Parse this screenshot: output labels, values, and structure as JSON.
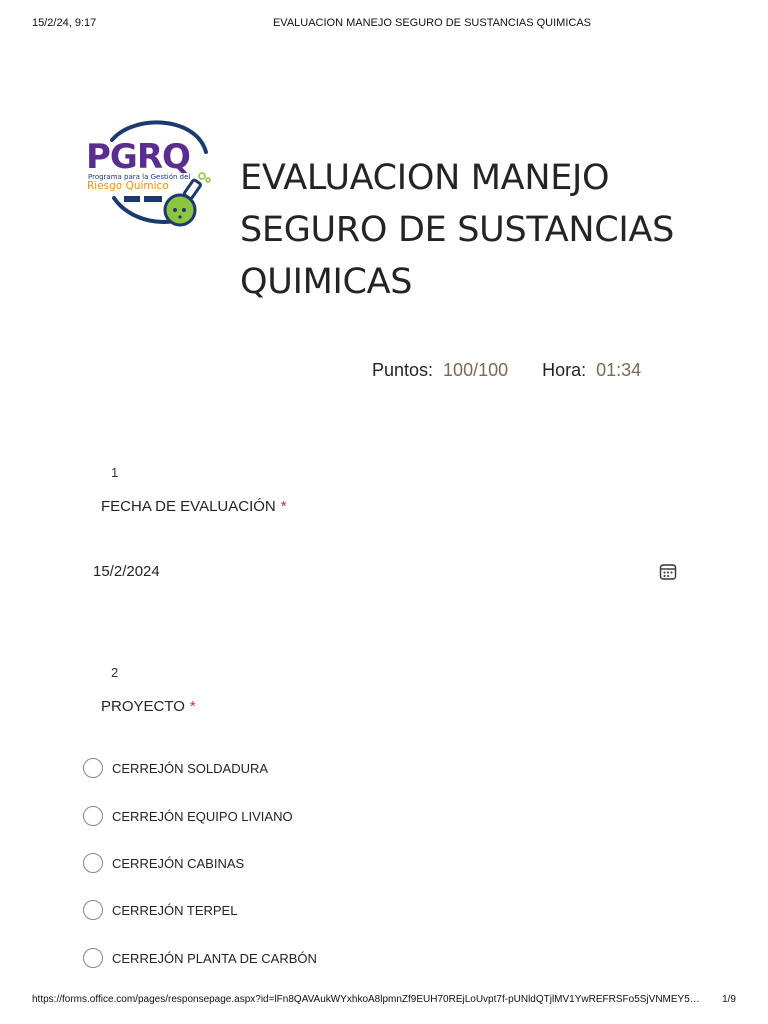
{
  "print_header": {
    "datetime": "15/2/24, 9:17",
    "title": "EVALUACION MANEJO SEGURO DE SUSTANCIAS QUIMICAS"
  },
  "logo": {
    "brand": "PGRQ",
    "line1": "Programa para la Gestión del",
    "line2": "Riesgo Químico",
    "colors": {
      "purple": "#5b2d8e",
      "green": "#8cc63f",
      "orange": "#f39200",
      "navy": "#1d3a6e"
    }
  },
  "form": {
    "title": "EVALUACION MANEJO SEGURO DE SUSTANCIAS QUIMICAS",
    "score_label": "Puntos:",
    "score_value": "100/100",
    "time_label": "Hora:",
    "time_value": "01:34"
  },
  "questions": [
    {
      "number": "1",
      "title": "FECHA DE EVALUACIÓN",
      "required_mark": "*",
      "answer": "15/2/2024",
      "icon": "calendar-icon"
    },
    {
      "number": "2",
      "title": "PROYECTO",
      "required_mark": "*",
      "options": [
        "CERREJÓN SOLDADURA",
        "CERREJÓN EQUIPO LIVIANO",
        "CERREJÓN CABINAS",
        "CERREJÓN TERPEL",
        "CERREJÓN PLANTA DE CARBÓN"
      ]
    }
  ],
  "print_footer": {
    "url": "https://forms.office.com/pages/responsepage.aspx?id=lFn8QAVAukWYxhkoA8lpmnZf9EUH70REjLoUvpt7f-pUNldQTjlMV1YwREFRSFo5SjVNMEY5…",
    "page": "1/9"
  },
  "accent_colors": {
    "score_value": "#7a6a52",
    "required": "#c4314b"
  }
}
